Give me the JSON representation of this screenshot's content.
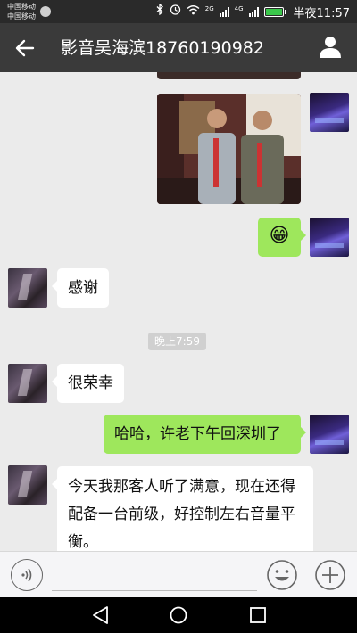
{
  "status_bar": {
    "carrier_1": "中国移动",
    "carrier_2": "中国移动",
    "net_2g": "2G",
    "net_4g": "4G",
    "time": "半夜11:57"
  },
  "header": {
    "title": "影音吴海滨18760190982"
  },
  "messages": [
    {
      "type": "image",
      "direction": "out"
    },
    {
      "type": "emoji",
      "direction": "out",
      "emoji": "😁"
    },
    {
      "type": "text",
      "direction": "in",
      "text": "感谢"
    },
    {
      "type": "time",
      "text": "晚上7:59"
    },
    {
      "type": "text",
      "direction": "in",
      "text": "很荣幸"
    },
    {
      "type": "text",
      "direction": "out",
      "text": "哈哈，许老下午回深圳了"
    },
    {
      "type": "text",
      "direction": "in",
      "text": "今天我那客人听了满意，现在还得配备一台前级，好控制左右音量平衡。"
    }
  ],
  "input_bar": {
    "text_value": "",
    "icons": [
      "voice-icon",
      "emoji-icon",
      "plus-icon"
    ]
  },
  "nav_bar": {
    "icons": [
      "back-icon",
      "home-icon",
      "recents-icon"
    ]
  },
  "colors": {
    "header_bg": "#3a3a3a",
    "status_bg": "#2a2a2a",
    "chat_bg": "#ebebeb",
    "outgoing_bubble": "#9ee75c",
    "incoming_bubble": "#ffffff"
  }
}
